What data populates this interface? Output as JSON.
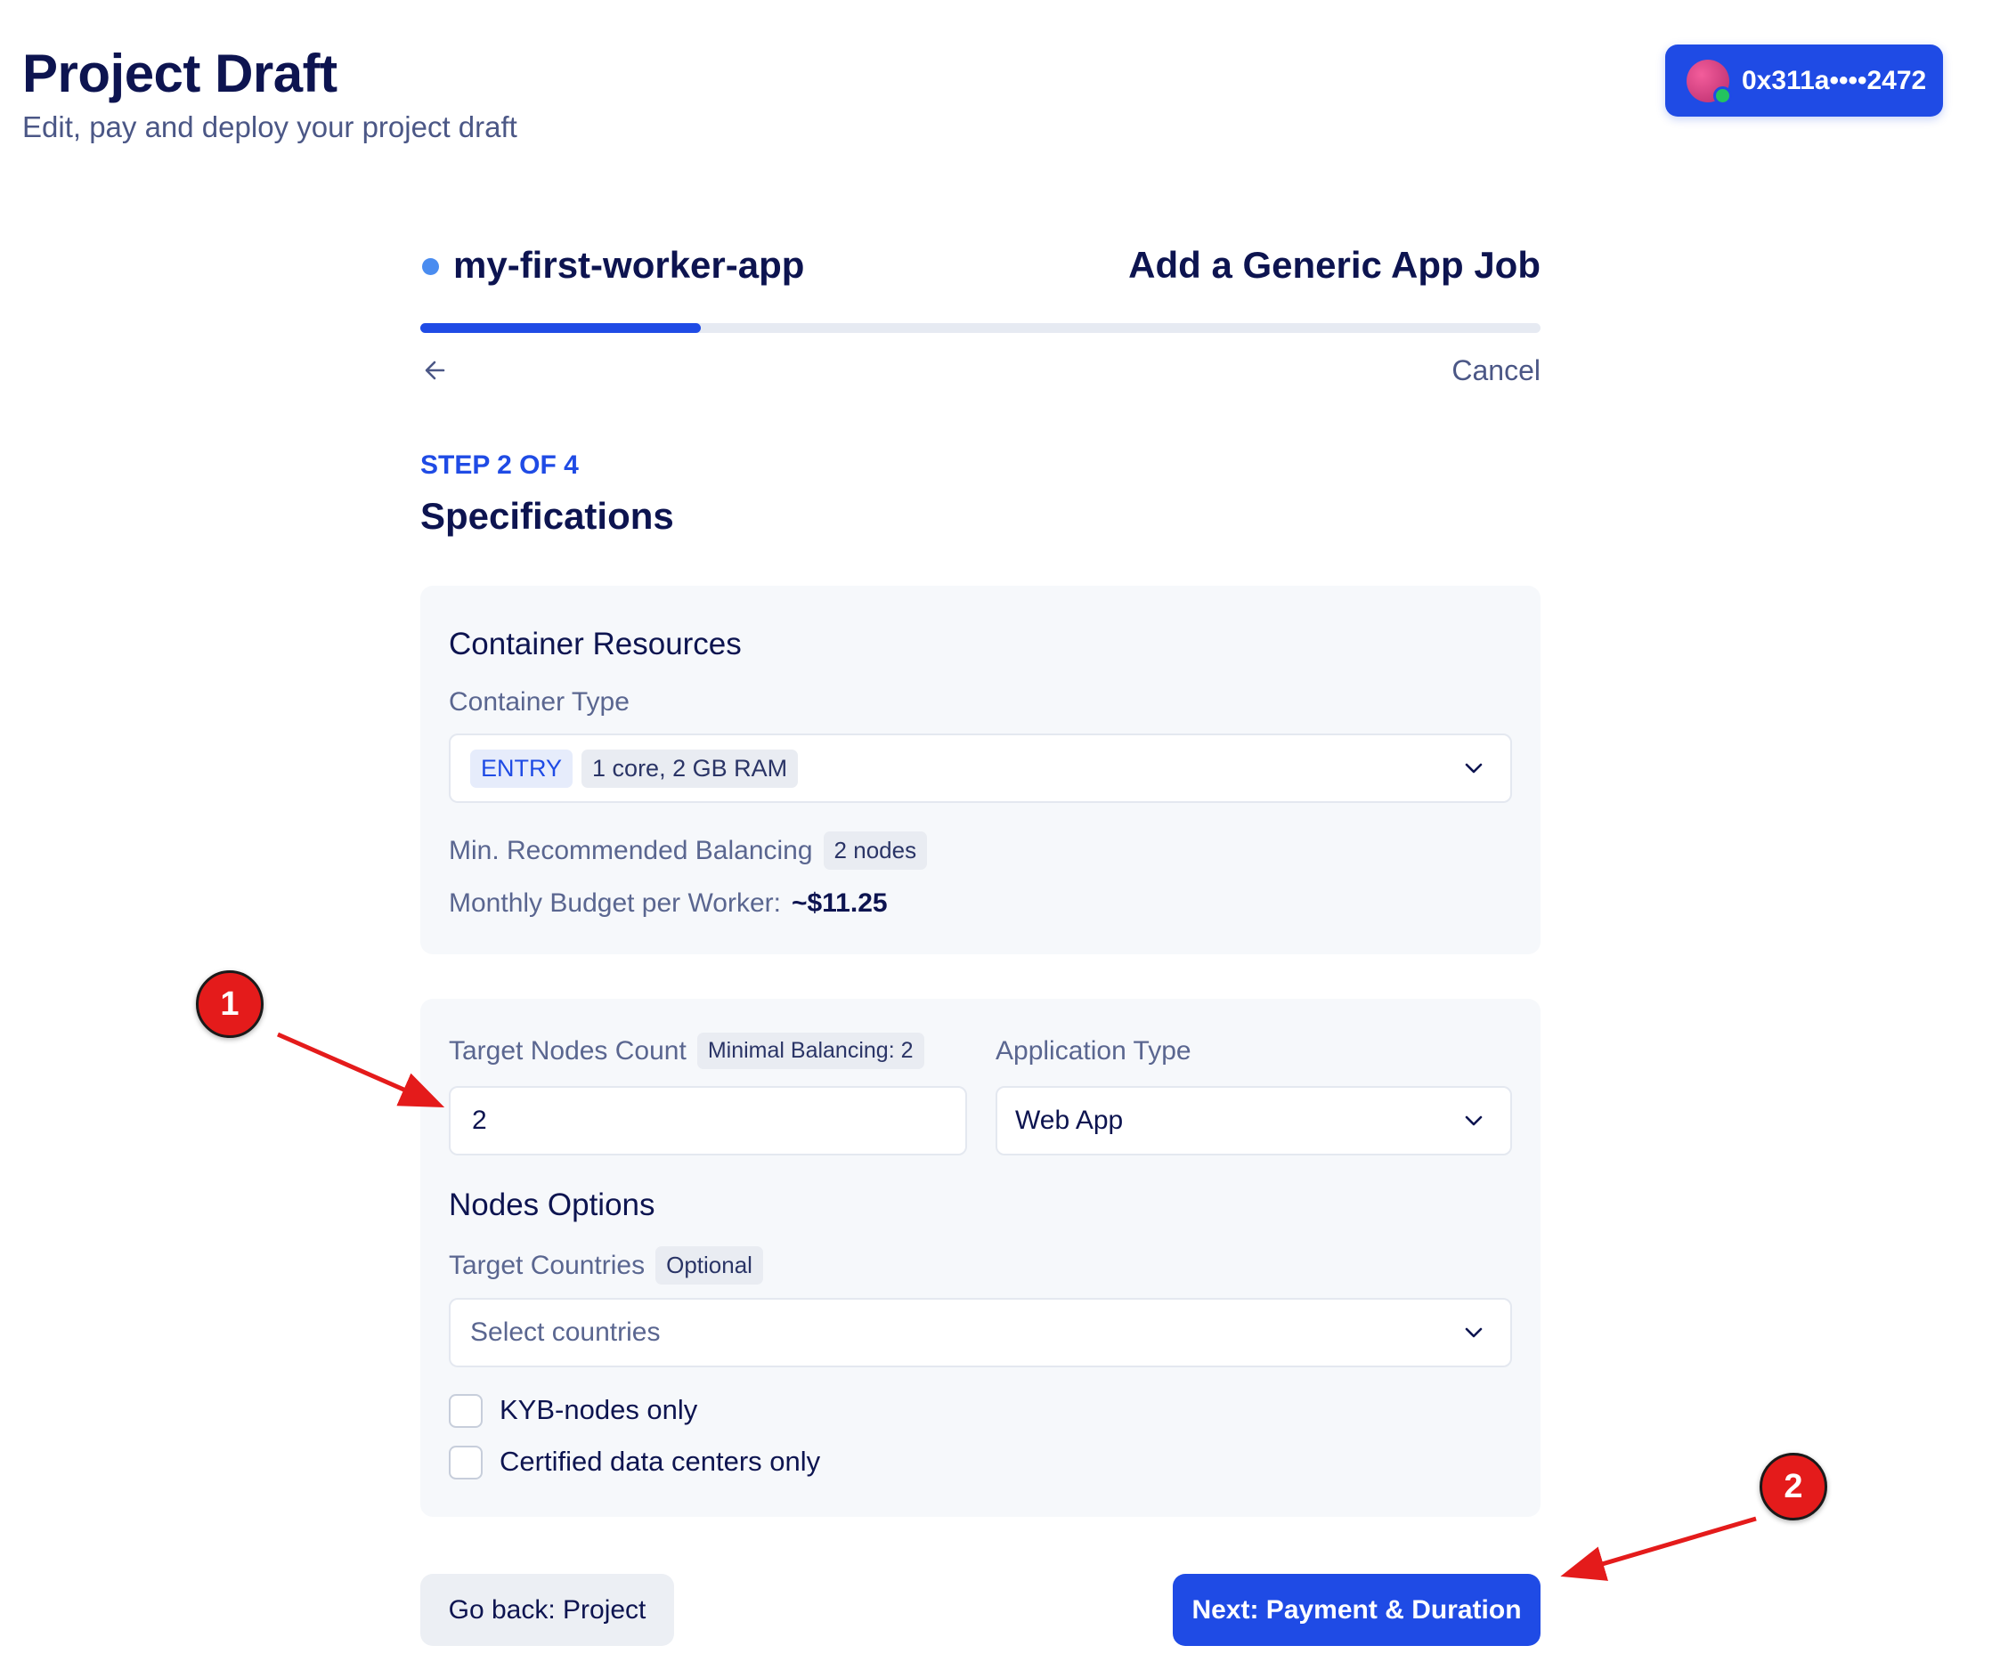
{
  "header": {
    "title": "Project Draft",
    "subtitle": "Edit, pay and deploy your project draft",
    "wallet_address": "0x311a••••2472"
  },
  "wizard": {
    "project_name": "my-first-worker-app",
    "job_title": "Add a Generic App Job",
    "progress_fraction": 0.25,
    "cancel_label": "Cancel",
    "step_label": "STEP 2 OF 4",
    "step_title": "Specifications"
  },
  "container_resources": {
    "heading": "Container Resources",
    "container_type_label": "Container Type",
    "container_type_tag": "ENTRY",
    "container_type_spec": "1 core, 2 GB RAM",
    "min_balancing_label": "Min. Recommended Balancing",
    "min_balancing_value": "2 nodes",
    "monthly_budget_label": "Monthly Budget per Worker:",
    "monthly_budget_value": "~$11.25"
  },
  "nodes": {
    "target_nodes_label": "Target Nodes Count",
    "target_nodes_badge": "Minimal Balancing: 2",
    "target_nodes_value": "2",
    "application_type_label": "Application Type",
    "application_type_value": "Web App",
    "options_heading": "Nodes Options",
    "target_countries_label": "Target Countries",
    "target_countries_badge": "Optional",
    "target_countries_placeholder": "Select countries",
    "kyb_label": "KYB-nodes only",
    "certified_label": "Certified data centers only"
  },
  "actions": {
    "back_label": "Go back: Project",
    "next_label": "Next: Payment & Duration"
  },
  "annotations": {
    "marker_1": "1",
    "marker_2": "2"
  },
  "colors": {
    "primary": "#1f4be5",
    "text_dark": "#0d1450",
    "annotation_red": "#e41b1b"
  }
}
